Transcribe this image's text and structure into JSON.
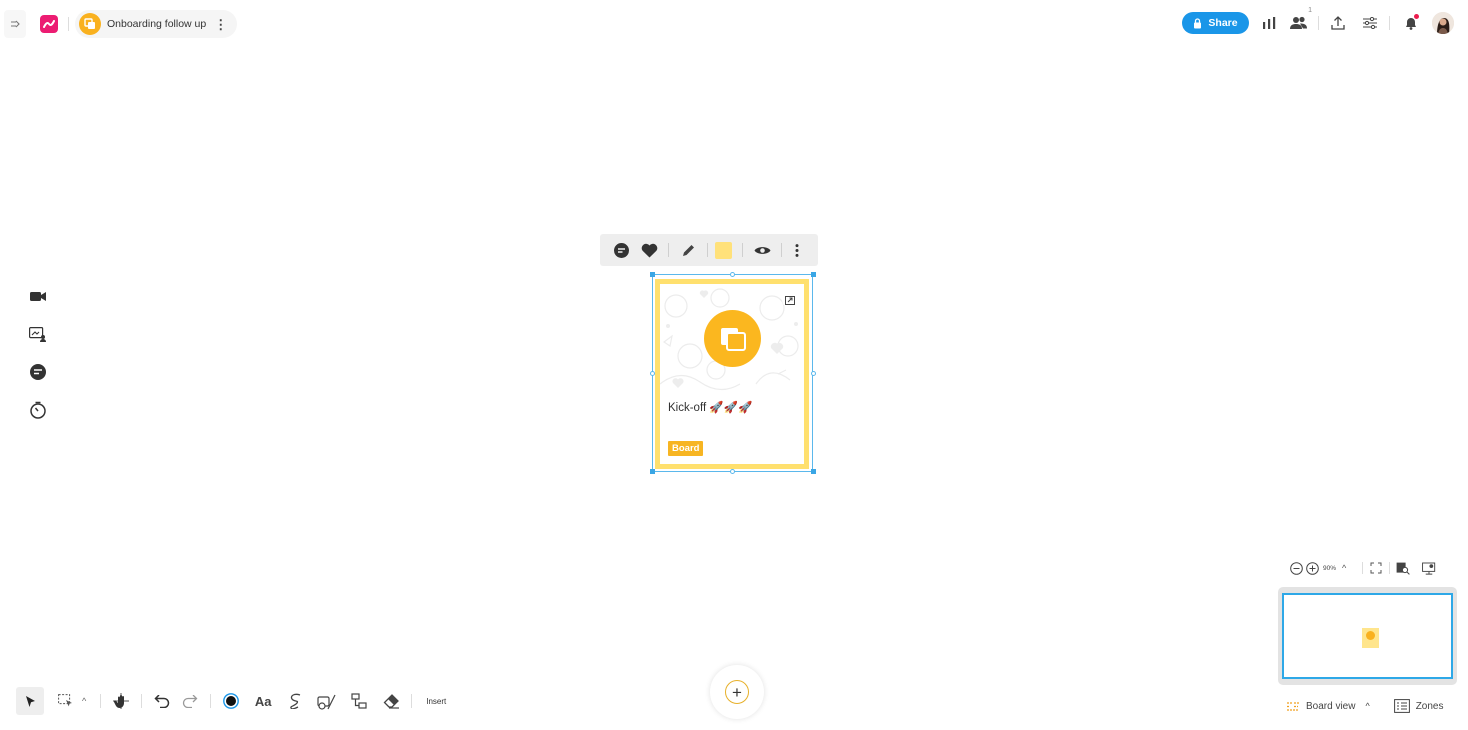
{
  "board": {
    "title": "Onboarding follow up",
    "more_icon": "⋮"
  },
  "header": {
    "share_label": "Share",
    "collaborators_count": "1"
  },
  "element_toolbar": {
    "items": [
      "comment-icon",
      "heart-icon",
      "pencil-icon",
      "color-swatch",
      "eye-icon",
      "more-vertical-icon"
    ],
    "swatch_color": "#ffe17a"
  },
  "card": {
    "title": "Kick-off 🚀🚀🚀",
    "badge": "Board",
    "border_color": "#ffe06e",
    "accent_color": "#fbb71f"
  },
  "bottom_toolbar": {
    "insert_label": "Insert",
    "text_tool_label": "Aa",
    "caret": "^"
  },
  "fab": {
    "label": "+"
  },
  "zoom": {
    "level": "90%",
    "caret": "^"
  },
  "footer": {
    "board_view_label": "Board view",
    "caret": "^",
    "zones_label": "Zones"
  },
  "colors": {
    "share_blue": "#1a96e8",
    "brand_pink": "#ec1c72",
    "selection_blue": "#5bb8ec",
    "board_yellow": "#f9b11f"
  }
}
